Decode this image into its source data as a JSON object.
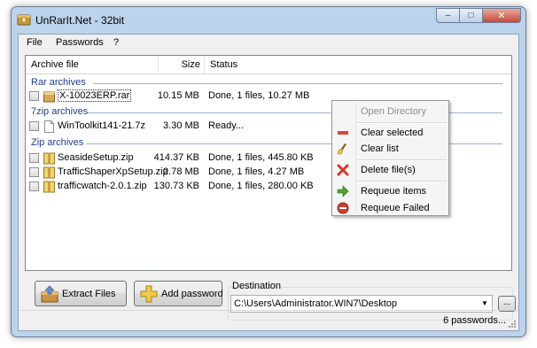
{
  "window": {
    "title": "UnRarIt.Net - 32bit"
  },
  "menu": {
    "items": [
      "File",
      "Passwords",
      "?"
    ]
  },
  "list": {
    "columns": [
      "Archive file",
      "Size",
      "Status"
    ],
    "groups": [
      {
        "name": "Rar archives",
        "rows": [
          {
            "file": "X-10023ERP.rar",
            "size": "10.15 MB",
            "status": "Done, 1 files, 10.27 MB",
            "icon": "rar-icon"
          }
        ]
      },
      {
        "name": "7zip archives",
        "rows": [
          {
            "file": "WinToolkit141-21.7z",
            "size": "3.30 MB",
            "status": "Ready...",
            "icon": "document-icon"
          }
        ]
      },
      {
        "name": "Zip archives",
        "rows": [
          {
            "file": "SeasideSetup.zip",
            "size": "414.37 KB",
            "status": "Done, 1 files, 445.80 KB",
            "icon": "zip-icon"
          },
          {
            "file": "TrafficShaperXpSetup.zip",
            "size": "2.78 MB",
            "status": "Done, 1 files, 4.27 MB",
            "icon": "zip-icon"
          },
          {
            "file": "trafficwatch-2.0.1.zip",
            "size": "130.73 KB",
            "status": "Done, 1 files, 280.00 KB",
            "icon": "zip-icon"
          }
        ]
      }
    ]
  },
  "context_menu": {
    "items": [
      {
        "label": "Open Directory",
        "enabled": false,
        "icon": ""
      },
      {
        "label": "Clear selected",
        "enabled": true,
        "icon": "red-bar-icon"
      },
      {
        "label": "Clear list",
        "enabled": true,
        "icon": "broom-icon"
      },
      {
        "label": "Delete file(s)",
        "enabled": true,
        "icon": "red-x-icon"
      },
      {
        "label": "Requeue items",
        "enabled": true,
        "icon": "green-arrow-icon"
      },
      {
        "label": "Requeue Failed",
        "enabled": true,
        "icon": "red-circle-icon"
      }
    ]
  },
  "buttons": {
    "extract": "Extract Files",
    "add_password": "Add password",
    "browse": "..."
  },
  "destination": {
    "label": "Destination",
    "value": "C:\\Users\\Administrator.WIN7\\Desktop"
  },
  "status": {
    "text": "6 passwords..."
  }
}
